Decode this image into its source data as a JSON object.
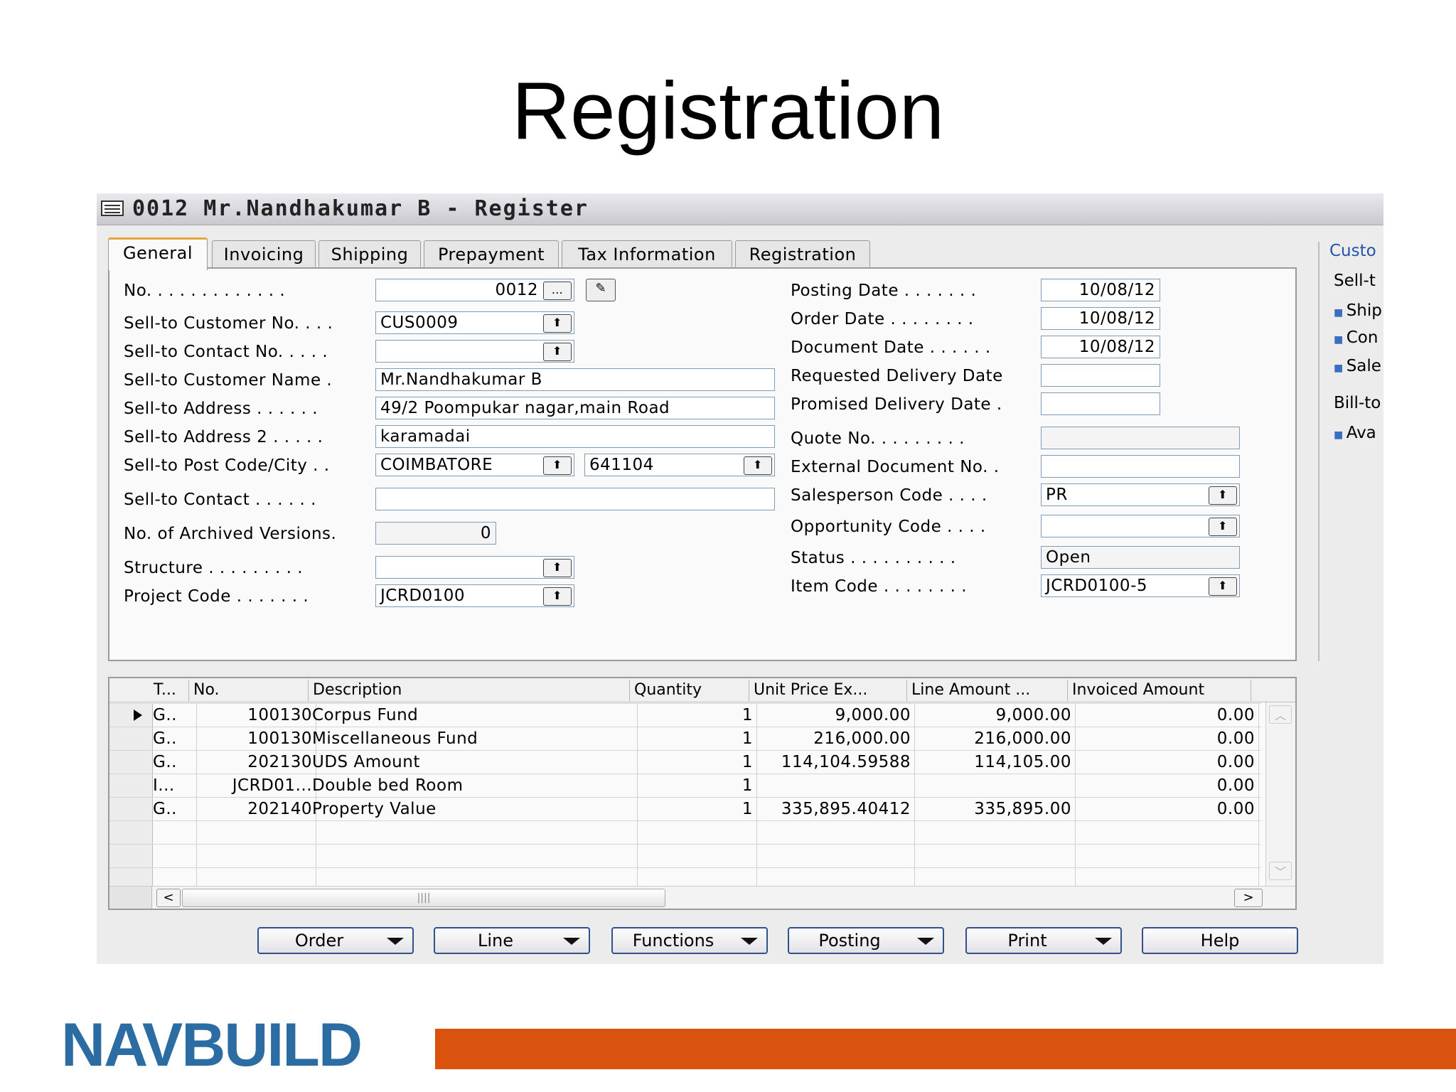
{
  "slide": {
    "title": "Registration",
    "logo_text": "NAVBUILD",
    "accent_color": "#d9530f",
    "logo_color": "#2b6ca3"
  },
  "window": {
    "title": "0012 Mr.Nandhakumar B - Register",
    "icon": "card-form-icon"
  },
  "tabs": [
    "General",
    "Invoicing",
    "Shipping",
    "Prepayment",
    "Tax Information",
    "Registration"
  ],
  "active_tab": "General",
  "left_fields": {
    "no": {
      "label": "No. . . . . . . . . . . . .",
      "value": "0012"
    },
    "customer_no": {
      "label": "Sell-to Customer No. . . .",
      "value": "CUS0009"
    },
    "contact_no": {
      "label": "Sell-to Contact No. . . . .",
      "value": ""
    },
    "customer_name": {
      "label": "Sell-to Customer Name .",
      "value": "Mr.Nandhakumar B"
    },
    "address": {
      "label": "Sell-to Address . . . . . .",
      "value": "49/2 Poompukar nagar,main Road"
    },
    "address2": {
      "label": "Sell-to Address 2 . . . . .",
      "value": "karamadai"
    },
    "post_code_city": {
      "label": "Sell-to Post Code/City . .",
      "value": "COIMBATORE",
      "value2": "641104"
    },
    "contact": {
      "label": "Sell-to Contact . . . . . .",
      "value": ""
    },
    "archived": {
      "label": "No. of Archived Versions.",
      "value": "0"
    },
    "structure": {
      "label": "Structure . . . . . . . . .",
      "value": ""
    },
    "project_code": {
      "label": "Project Code . . . . . . .",
      "value": "JCRD0100"
    }
  },
  "right_fields": {
    "posting_date": {
      "label": "Posting Date . . . . . . .",
      "value": "10/08/12"
    },
    "order_date": {
      "label": "Order Date . . . . . . . .",
      "value": "10/08/12"
    },
    "document_date": {
      "label": "Document Date . . . . . .",
      "value": "10/08/12"
    },
    "requested_delivery": {
      "label": "Requested Delivery Date",
      "value": ""
    },
    "promised_delivery": {
      "label": "Promised Delivery Date .",
      "value": ""
    },
    "quote_no": {
      "label": "Quote No. . . . . . . . .",
      "value": ""
    },
    "external_doc": {
      "label": "External Document No. .",
      "value": ""
    },
    "salesperson": {
      "label": "Salesperson Code . . . .",
      "value": "PR"
    },
    "opportunity": {
      "label": "Opportunity Code . . . .",
      "value": ""
    },
    "status": {
      "label": "Status . . . . . . . . . .",
      "value": "Open"
    },
    "item_code": {
      "label": "Item Code . . . . . . . .",
      "value": "JCRD0100-5"
    }
  },
  "side_pane": {
    "title": "Custo",
    "items": [
      "Sell-t",
      "Ship",
      "Con",
      "Sale",
      "Bill-to",
      "Ava"
    ]
  },
  "grid": {
    "headers": [
      "T...",
      "No.",
      "Description",
      "Quantity",
      "Unit Price Ex...",
      "Line Amount ...",
      "Invoiced Amount"
    ],
    "rows": [
      {
        "t": "G..",
        "no": "100130",
        "desc": "Corpus Fund",
        "qty": "1",
        "price": "9,000.00",
        "line": "9,000.00",
        "inv": "0.00"
      },
      {
        "t": "G..",
        "no": "100130",
        "desc": "Miscellaneous Fund",
        "qty": "1",
        "price": "216,000.00",
        "line": "216,000.00",
        "inv": "0.00"
      },
      {
        "t": "G..",
        "no": "202130",
        "desc": "UDS Amount",
        "qty": "1",
        "price": "114,104.59588",
        "line": "114,105.00",
        "inv": "0.00"
      },
      {
        "t": "I...",
        "no": "JCRD01...",
        "desc": "Double bed Room",
        "qty": "1",
        "price": "",
        "line": "",
        "inv": "0.00"
      },
      {
        "t": "G..",
        "no": "202140",
        "desc": "Property Value",
        "qty": "1",
        "price": "335,895.40412",
        "line": "335,895.00",
        "inv": "0.00"
      }
    ]
  },
  "buttons": {
    "order": "Order",
    "line": "Line",
    "functions": "Functions",
    "posting": "Posting",
    "print": "Print",
    "help": "Help"
  }
}
